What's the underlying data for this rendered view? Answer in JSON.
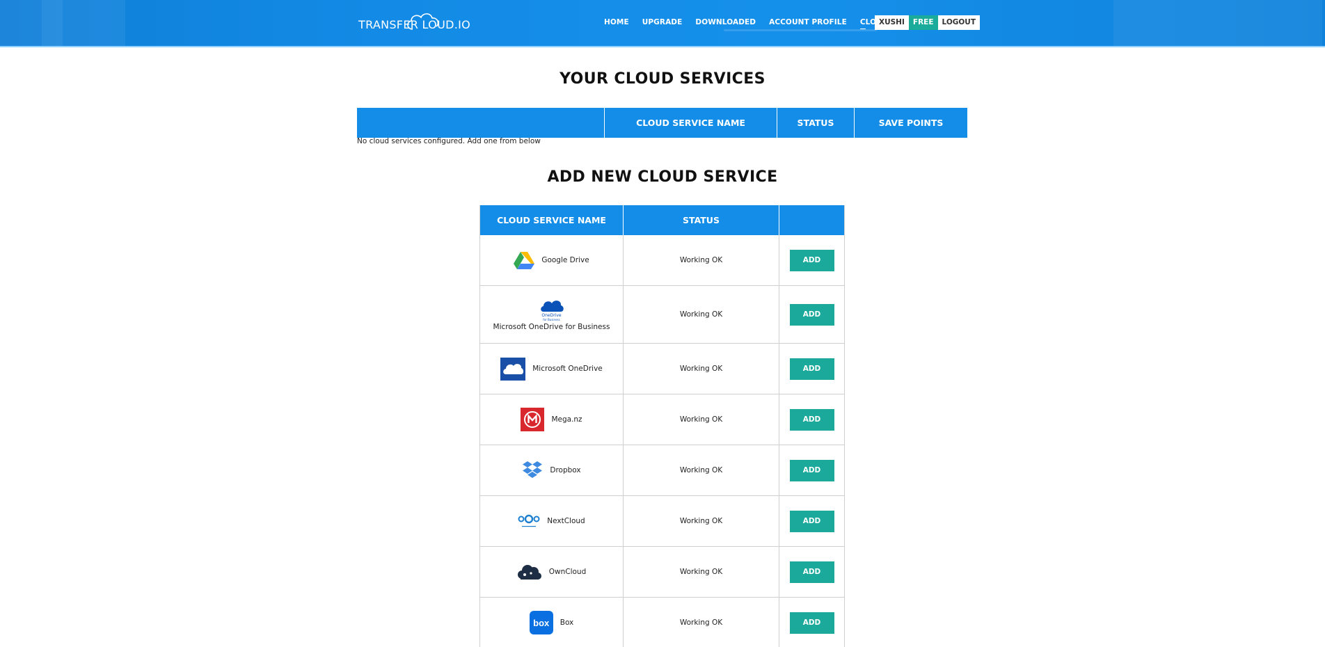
{
  "header": {
    "logo_text": "TRANSFER LOUD.IO",
    "nav": [
      "HOME",
      "UPGRADE",
      "DOWNLOADED",
      "ACCOUNT PROFILE",
      "CLOUDS"
    ],
    "username": "XUSHI",
    "plan": "FREE",
    "logout": "LOGOUT"
  },
  "your_services": {
    "title": "YOUR CLOUD SERVICES",
    "columns": [
      "",
      "CLOUD SERVICE NAME",
      "STATUS",
      "SAVE POINTS"
    ],
    "empty_message": "No cloud services configured. Add one from below"
  },
  "add_services": {
    "title": "ADD NEW CLOUD SERVICE",
    "columns": [
      "CLOUD SERVICE NAME",
      "STATUS",
      ""
    ],
    "add_label": "ADD",
    "rows": [
      {
        "name": "Google Drive",
        "status": "Working OK",
        "icon": "google-drive-icon"
      },
      {
        "name": "Microsoft OneDrive for Business",
        "status": "Working OK",
        "icon": "onedrive-business-icon",
        "icon_caption": "OneDrive",
        "icon_subcaption": "for Business"
      },
      {
        "name": "Microsoft OneDrive",
        "status": "Working OK",
        "icon": "onedrive-icon"
      },
      {
        "name": "Mega.nz",
        "status": "Working OK",
        "icon": "mega-icon"
      },
      {
        "name": "Dropbox",
        "status": "Working OK",
        "icon": "dropbox-icon"
      },
      {
        "name": "NextCloud",
        "status": "Working OK",
        "icon": "nextcloud-icon"
      },
      {
        "name": "OwnCloud",
        "status": "Working OK",
        "icon": "owncloud-icon"
      },
      {
        "name": "Box",
        "status": "Working OK",
        "icon": "box-icon",
        "icon_caption": "box"
      }
    ]
  },
  "colors": {
    "header_blue": "#138be6",
    "table_header_blue": "#138de8",
    "add_button": "#1aa99a",
    "plan_badge": "#1aab9b"
  }
}
